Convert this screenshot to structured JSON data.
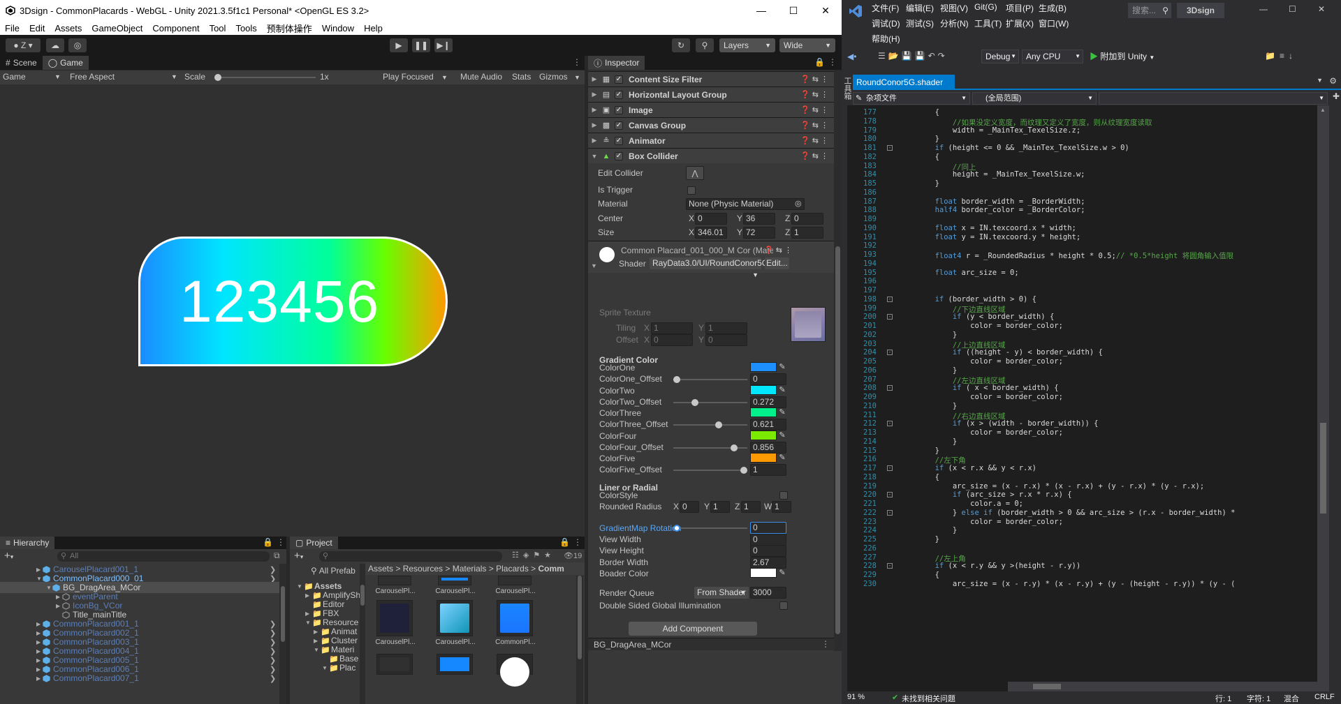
{
  "unity": {
    "title": "3Dsign - CommonPlacards - WebGL - Unity 2021.3.5f1c1 Personal* <OpenGL ES 3.2>",
    "menu": [
      "File",
      "Edit",
      "Assets",
      "GameObject",
      "Component",
      "Tool",
      "Tools",
      "预制体操作",
      "Window",
      "Help"
    ],
    "toolbar": {
      "account": "Z",
      "layers": "Layers",
      "layout": "Wide"
    },
    "tabs": {
      "scene": "Scene",
      "game": "Game",
      "inspector": "Inspector",
      "hierarchy": "Hierarchy",
      "project": "Project"
    },
    "gamebar": {
      "display": "Game",
      "aspect": "Free Aspect",
      "scale_label": "Scale",
      "scale_value": "1x",
      "play_mode": "Play Focused",
      "mute": "Mute Audio",
      "stats": "Stats",
      "gizmos": "Gizmos"
    },
    "placard": {
      "text": "123456",
      "gradient": [
        "#1a8cff",
        "#00e5ff",
        "#00ff99",
        "#66ff00",
        "#ff9900"
      ]
    },
    "components": [
      "Content Size Filter",
      "Horizontal Layout Group",
      "Image",
      "Canvas Group",
      "Animator",
      "Box Collider"
    ],
    "box_collider": {
      "edit_collider": "Edit Collider",
      "is_trigger": "Is Trigger",
      "material_label": "Material",
      "material_value": "None (Physic Material)",
      "center_label": "Center",
      "center": {
        "x": "0",
        "y": "36",
        "z": "0"
      },
      "size_label": "Size",
      "size": {
        "x": "346.01",
        "y": "72",
        "z": "1"
      },
      "axis": {
        "x": "X",
        "y": "Y",
        "z": "Z",
        "w": "W"
      }
    },
    "material": {
      "name": "Common Placard_001_000_M Cor (Mate",
      "shader_label": "Shader",
      "shader_value": "RayData3.0/UI/RoundConor5G",
      "edit": "Edit...",
      "sprite_texture": "Sprite Texture",
      "tiling": "Tiling",
      "tiling_x": "1",
      "tiling_y": "1",
      "offset": "Offset",
      "offset_x": "0",
      "offset_y": "0",
      "gradient_header": "Gradient Color",
      "color_one": "ColorOne",
      "color_one_offset": "ColorOne_Offset",
      "color_one_offset_value": "0",
      "color_two": "ColorTwo",
      "color_two_offset": "ColorTwo_Offset",
      "color_two_offset_value": "0.272",
      "color_three": "ColorThree",
      "color_three_offset": "ColorThree_Offset",
      "color_three_offset_value": "0.621",
      "color_four": "ColorFour",
      "color_four_offset": "ColorFour_Offset",
      "color_four_offset_value": "0.856",
      "color_five": "ColorFive",
      "color_five_offset": "ColorFive_Offset",
      "color_five_offset_value": "1",
      "swatches": [
        "#1e8fff",
        "#00e8ff",
        "#00f08c",
        "#7bea00",
        "#ff9a00"
      ],
      "liner_header": "Liner or Radial",
      "color_style": "ColorStyle",
      "rounded_radius": "Rounded Radius",
      "rr_x": "0",
      "rr_y": "1",
      "rr_z": "1",
      "rr_w": "1",
      "gradient_rotation": "GradientMap Rotation",
      "gradient_rotation_value": "0",
      "view_width": "View Width",
      "view_width_value": "0",
      "view_height": "View Height",
      "view_height_value": "0",
      "border_width": "Border Width",
      "border_width_value": "2.67",
      "border_color": "Boader Color",
      "render_queue": "Render Queue",
      "render_queue_mode": "From Shader",
      "render_queue_value": "3000",
      "double_sided": "Double Sided Global Illumination"
    },
    "add_component": "Add Component",
    "preview_label": "BG_DragArea_MCor",
    "hierarchy": {
      "search_placeholder": "All",
      "items": [
        {
          "label": "CarouselPlacard001_1",
          "dim": true
        },
        {
          "label": "CommonPlacard000_01",
          "dim": false
        },
        {
          "label": "BG_DragArea_MCor",
          "dim": false
        },
        {
          "label": "eventParent",
          "dim": true
        },
        {
          "label": "IconBg_VCor",
          "dim": true
        },
        {
          "label": "Title_mainTitle",
          "dim": false
        },
        {
          "label": "CommonPlacard001_1",
          "dim": true
        },
        {
          "label": "CommonPlacard002_1",
          "dim": true
        },
        {
          "label": "CommonPlacard003_1",
          "dim": true
        },
        {
          "label": "CommonPlacard004_1",
          "dim": true
        },
        {
          "label": "CommonPlacard005_1",
          "dim": true
        },
        {
          "label": "CommonPlacard006_1",
          "dim": true
        },
        {
          "label": "CommonPlacard007_1",
          "dim": true
        }
      ]
    },
    "project": {
      "count": "19",
      "all_prefabs": "All Prefab",
      "breadcrumb": [
        "Assets",
        "Resources",
        "Materials",
        "Placards",
        "Comm"
      ],
      "tree": [
        "Assets",
        "AmplifySh",
        "Editor",
        "FBX",
        "Resource",
        "Animat",
        "Cluster",
        "Materi",
        "Base",
        "Plac"
      ],
      "assets": [
        "CarouselPl...",
        "CarouselPl...",
        "CarouselPl...",
        "CarouselPl...",
        "CarouselPl...",
        "CommonPl..."
      ]
    }
  },
  "vs": {
    "menu_row1": [
      "文件(F)",
      "编辑(E)",
      "视图(V)",
      "Git(G)",
      "项目(P)",
      "生成(B)"
    ],
    "menu_row2": [
      "调试(D)",
      "测试(S)",
      "分析(N)",
      "工具(T)",
      "扩展(X)",
      "窗口(W)"
    ],
    "menu_row3": [
      "帮助(H)"
    ],
    "search": "搜索...",
    "solution": "3Dsign",
    "config": "Debug",
    "platform": "Any CPU",
    "attach": "附加到 Unity",
    "tab": "RoundConor5G.shader",
    "scope_left": "杂项文件",
    "scope_right": "(全局范围)",
    "side_toolbox": "工具箱",
    "lines": [
      {
        "n": "177",
        "t": "        {"
      },
      {
        "n": "178",
        "t": "            //如果没定义宽度，而纹理又定义了宽度，则从纹理宽度读取",
        "c": "cm"
      },
      {
        "n": "179",
        "t": "            width = _MainTex_TexelSize.z;"
      },
      {
        "n": "180",
        "t": "        }"
      },
      {
        "n": "181",
        "t": "        if (height <= 0 && _MainTex_TexelSize.w > 0)",
        "k": "if"
      },
      {
        "n": "182",
        "t": "        {"
      },
      {
        "n": "183",
        "t": "            //同上",
        "c": "cm"
      },
      {
        "n": "184",
        "t": "            height = _MainTex_TexelSize.w;"
      },
      {
        "n": "185",
        "t": "        }"
      },
      {
        "n": "186",
        "t": ""
      },
      {
        "n": "187",
        "t": "        float border_width = _BorderWidth;",
        "k": "float"
      },
      {
        "n": "188",
        "t": "        half4 border_color = _BorderColor;",
        "k": "half4"
      },
      {
        "n": "189",
        "t": ""
      },
      {
        "n": "190",
        "t": "        float x = IN.texcoord.x * width;",
        "k": "float"
      },
      {
        "n": "191",
        "t": "        float y = IN.texcoord.y * height;",
        "k": "float"
      },
      {
        "n": "192",
        "t": ""
      },
      {
        "n": "193",
        "t": "        float4 r = _RoundedRadius * height * 0.5;// *0.5*height 将圆角输入值限",
        "k": "float4"
      },
      {
        "n": "194",
        "t": ""
      },
      {
        "n": "195",
        "t": "        float arc_size = 0;",
        "k": "float"
      },
      {
        "n": "196",
        "t": ""
      },
      {
        "n": "197",
        "t": ""
      },
      {
        "n": "198",
        "t": "        if (border_width > 0) {",
        "k": "if"
      },
      {
        "n": "199",
        "t": "            //下边直线区域",
        "c": "cm"
      },
      {
        "n": "200",
        "t": "            if (y < border_width) {",
        "k": "if"
      },
      {
        "n": "201",
        "t": "                color = border_color;"
      },
      {
        "n": "202",
        "t": "            }"
      },
      {
        "n": "203",
        "t": "            //上边直线区域",
        "c": "cm"
      },
      {
        "n": "204",
        "t": "            if ((height - y) < border_width) {",
        "k": "if"
      },
      {
        "n": "205",
        "t": "                color = border_color;"
      },
      {
        "n": "206",
        "t": "            }"
      },
      {
        "n": "207",
        "t": "            //左边直线区域",
        "c": "cm"
      },
      {
        "n": "208",
        "t": "            if ( x < border_width) {",
        "k": "if"
      },
      {
        "n": "209",
        "t": "                color = border_color;"
      },
      {
        "n": "210",
        "t": "            }"
      },
      {
        "n": "211",
        "t": "            //右边直线区域",
        "c": "cm"
      },
      {
        "n": "212",
        "t": "            if (x > (width - border_width)) {",
        "k": "if"
      },
      {
        "n": "213",
        "t": "                color = border_color;"
      },
      {
        "n": "214",
        "t": "            }"
      },
      {
        "n": "215",
        "t": "        }"
      },
      {
        "n": "216",
        "t": "        //左下角",
        "c": "cm"
      },
      {
        "n": "217",
        "t": "        if (x < r.x && y < r.x)",
        "k": "if"
      },
      {
        "n": "218",
        "t": "        {"
      },
      {
        "n": "219",
        "t": "            arc_size = (x - r.x) * (x - r.x) + (y - r.x) * (y - r.x);"
      },
      {
        "n": "220",
        "t": "            if (arc_size > r.x * r.x) {",
        "k": "if"
      },
      {
        "n": "221",
        "t": "                color.a = 0;"
      },
      {
        "n": "222",
        "t": "            } else if (border_width > 0 && arc_size > (r.x - border_width) *",
        "k": "else if"
      },
      {
        "n": "223",
        "t": "                color = border_color;"
      },
      {
        "n": "224",
        "t": "            }"
      },
      {
        "n": "225",
        "t": "        }"
      },
      {
        "n": "226",
        "t": ""
      },
      {
        "n": "227",
        "t": "        //左上角",
        "c": "cm"
      },
      {
        "n": "228",
        "t": "        if (x < r.y && y >(height - r.y))",
        "k": "if"
      },
      {
        "n": "229",
        "t": "        {"
      },
      {
        "n": "230",
        "t": "            arc_size = (x - r.y) * (x - r.y) + (y - (height - r.y)) * (y - ("
      }
    ],
    "status": {
      "zoom": "91 %",
      "issues": "未找到相关问题",
      "line": "行: 1",
      "char": "字符: 1",
      "mixed": "混合",
      "eol": "CRLF"
    }
  }
}
